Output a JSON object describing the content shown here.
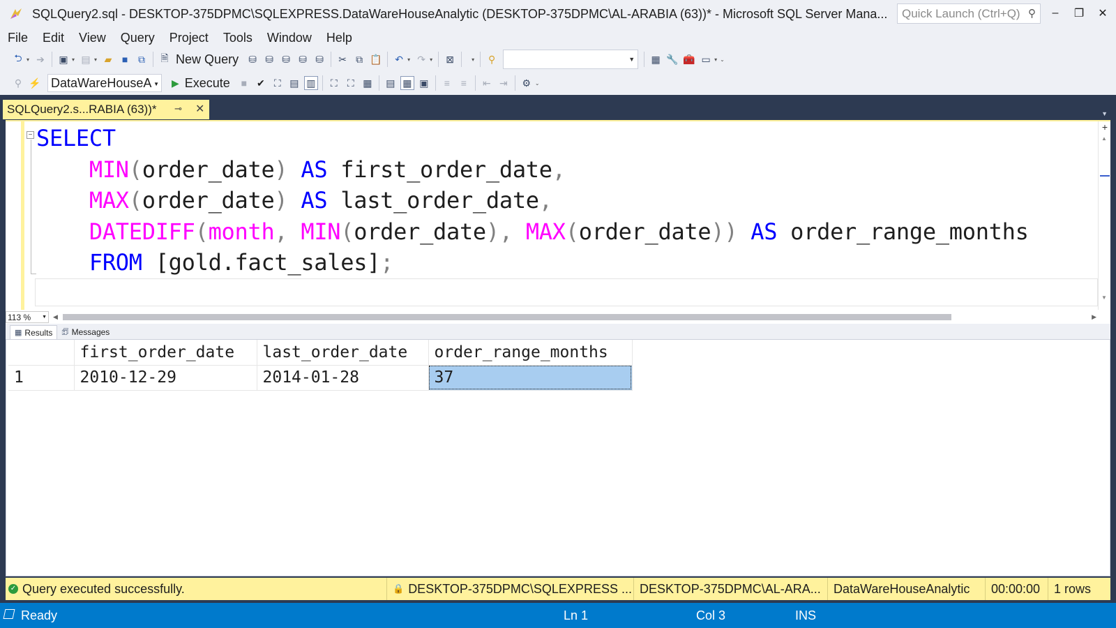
{
  "window": {
    "title": "SQLQuery2.sql - DESKTOP-375DPMC\\SQLEXPRESS.DataWareHouseAnalytic (DESKTOP-375DPMC\\AL-ARABIA (63))* - Microsoft SQL Server Mana...",
    "quick_launch_placeholder": "Quick Launch (Ctrl+Q)"
  },
  "menu": [
    "File",
    "Edit",
    "View",
    "Query",
    "Project",
    "Tools",
    "Window",
    "Help"
  ],
  "toolbar": {
    "new_query_label": "New Query",
    "database": "DataWareHouseA",
    "execute_label": "Execute"
  },
  "document_tab": {
    "title": "SQLQuery2.s...RABIA (63))*"
  },
  "editor": {
    "lines": [
      [
        {
          "t": "SELECT",
          "c": "kw"
        }
      ],
      [
        {
          "t": "    "
        },
        {
          "t": "MIN",
          "c": "fn"
        },
        {
          "t": "(",
          "c": "op"
        },
        {
          "t": "order_date"
        },
        {
          "t": ")",
          "c": "op"
        },
        {
          "t": " "
        },
        {
          "t": "AS",
          "c": "kw"
        },
        {
          "t": " first_order_date"
        },
        {
          "t": ",",
          "c": "op"
        }
      ],
      [
        {
          "t": "    "
        },
        {
          "t": "MAX",
          "c": "fn"
        },
        {
          "t": "(",
          "c": "op"
        },
        {
          "t": "order_date"
        },
        {
          "t": ")",
          "c": "op"
        },
        {
          "t": " "
        },
        {
          "t": "AS",
          "c": "kw"
        },
        {
          "t": " last_order_date"
        },
        {
          "t": ",",
          "c": "op"
        }
      ],
      [
        {
          "t": "    "
        },
        {
          "t": "DATEDIFF",
          "c": "fn"
        },
        {
          "t": "(",
          "c": "op"
        },
        {
          "t": "month",
          "c": "fn"
        },
        {
          "t": ",",
          "c": "op"
        },
        {
          "t": " "
        },
        {
          "t": "MIN",
          "c": "fn"
        },
        {
          "t": "(",
          "c": "op"
        },
        {
          "t": "order_date"
        },
        {
          "t": "),",
          "c": "op"
        },
        {
          "t": " "
        },
        {
          "t": "MAX",
          "c": "fn"
        },
        {
          "t": "(",
          "c": "op"
        },
        {
          "t": "order_date"
        },
        {
          "t": "))",
          "c": "op"
        },
        {
          "t": " "
        },
        {
          "t": "AS",
          "c": "kw"
        },
        {
          "t": " order_range_months"
        }
      ],
      [
        {
          "t": "    "
        },
        {
          "t": "FROM",
          "c": "kw"
        },
        {
          "t": " [gold.fact_sales]"
        },
        {
          "t": ";",
          "c": "op"
        }
      ]
    ],
    "zoom": "113 %"
  },
  "results": {
    "tabs": [
      "Results",
      "Messages"
    ],
    "columns": [
      "first_order_date",
      "last_order_date",
      "order_range_months"
    ],
    "rows": [
      {
        "num": "1",
        "cells": [
          "2010-12-29",
          "2014-01-28",
          "37"
        ]
      }
    ]
  },
  "query_status": {
    "message": "Query executed successfully.",
    "server": "DESKTOP-375DPMC\\SQLEXPRESS ...",
    "user": "DESKTOP-375DPMC\\AL-ARA...",
    "database": "DataWareHouseAnalytic",
    "elapsed": "00:00:00",
    "rows": "1 rows"
  },
  "statusbar": {
    "state": "Ready",
    "line": "Ln 1",
    "col": "Col 3",
    "mode": "INS"
  },
  "colors": {
    "keyword": "#0000ff",
    "function": "#ff00ff",
    "operator": "#808080",
    "status_bar": "#007acc",
    "tab_highlight": "#fff29d",
    "selected_cell": "#a8cdf0"
  }
}
